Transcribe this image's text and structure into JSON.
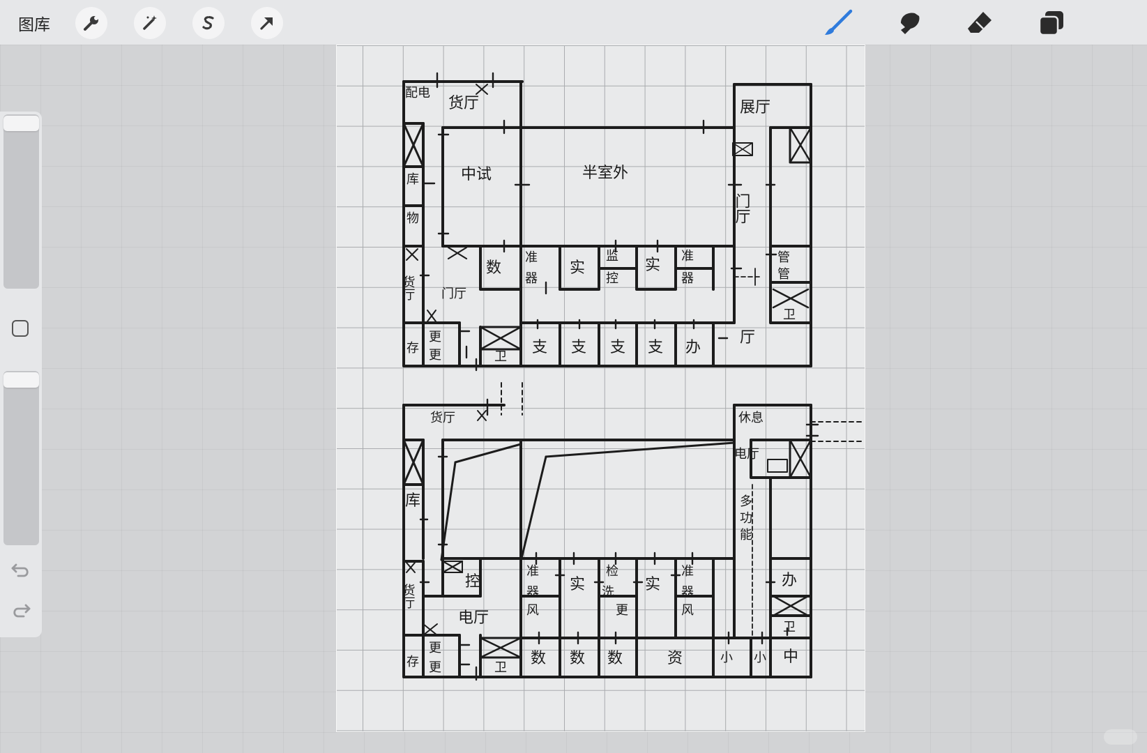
{
  "toolbar": {
    "gallery_label": "图库",
    "left_tools": [
      "wrench-icon",
      "magic-wand-icon",
      "selection-s-icon",
      "move-arrow-icon"
    ],
    "right_tools": [
      "brush-icon",
      "smudge-icon",
      "eraser-icon",
      "layers-icon"
    ],
    "accent_color": "#2f7bdc"
  },
  "sidebar": {
    "brush_size": 0.9,
    "opacity": 0.9
  },
  "plan_top": {
    "labels": {
      "cargo_hall": "货厅",
      "power": "配电",
      "warehouse": "库",
      "goods": "物",
      "mid_test": "中试",
      "semi_outdoor": "半室外",
      "exhibition": "展厅",
      "gate_hall_right": "门厅",
      "gate_hall_mid": "门厅",
      "cargo_hall_left": "货厅",
      "data": "数",
      "prep1": "准",
      "instr1": "器",
      "lab1": "实",
      "monitor1": "监",
      "control1": "控",
      "lab2": "实",
      "prep2": "准",
      "instr2": "器",
      "manage1": "管",
      "manage2": "管",
      "toilet_right": "卫",
      "store": "存",
      "change1": "更",
      "change2": "更",
      "toilet_left": "卫",
      "cls1": "支",
      "cls2": "支",
      "cls3": "支",
      "cls4": "支",
      "office": "办",
      "hall": "厅"
    }
  },
  "plan_bottom": {
    "labels": {
      "cargo_hall": "货厅",
      "warehouse": "库",
      "rest": "休息",
      "elevator_hall": "电厅",
      "multi1": "多",
      "multi2": "功",
      "multi3": "能",
      "cargo_hall_left": "货厅",
      "control": "控",
      "elec_hall": "电厅",
      "prep1": "准",
      "instr1": "器",
      "fan1": "风",
      "lab1": "实",
      "detect": "检",
      "wash": "洗",
      "change_mid": "更",
      "lab2": "实",
      "prep2": "准",
      "instr2": "器",
      "fan2": "风",
      "office": "办",
      "toilet_right": "卫",
      "store": "存",
      "change1": "更",
      "change2": "更",
      "toilet_left": "卫",
      "data1": "数",
      "data2": "数",
      "data3": "数",
      "resource": "资",
      "small1": "小",
      "small2": "小",
      "medium": "中"
    }
  }
}
